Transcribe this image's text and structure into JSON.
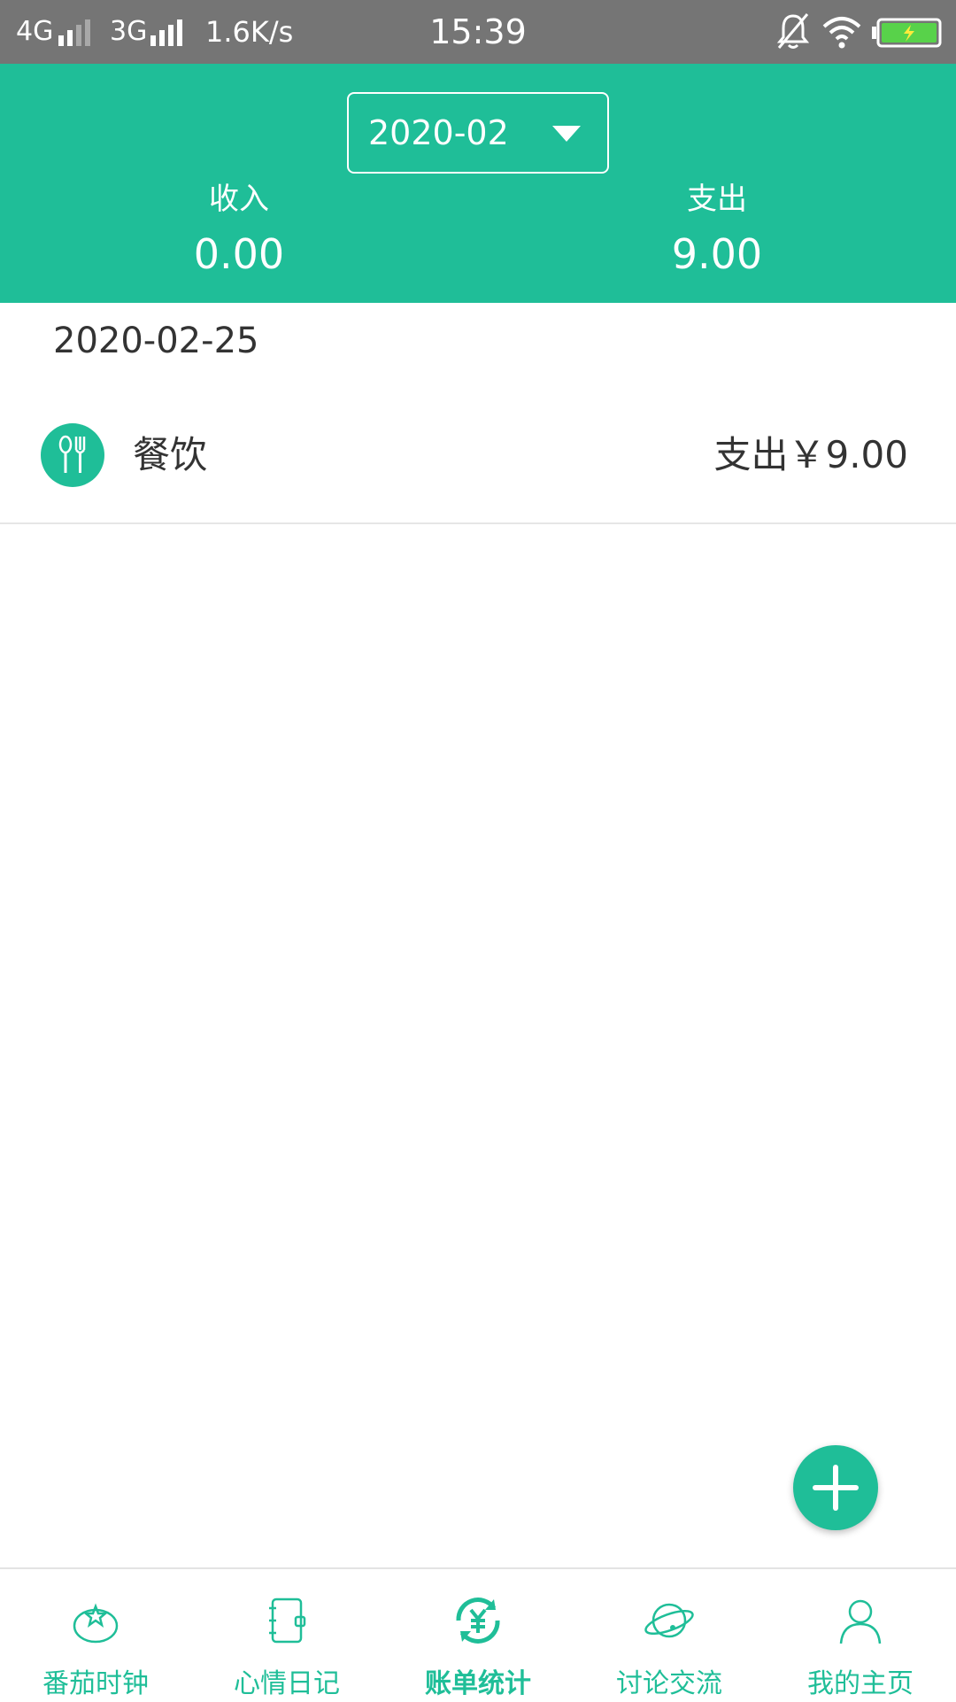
{
  "status_bar": {
    "network1": "4G",
    "network2": "3G",
    "speed": "1.6K/s",
    "time": "15:39",
    "icons": [
      "signal-icon",
      "mute-icon",
      "wifi-icon",
      "battery-charging-icon"
    ]
  },
  "header": {
    "month": "2020-02",
    "income_label": "收入",
    "income_value": "0.00",
    "expense_label": "支出",
    "expense_value": "9.00"
  },
  "records": {
    "date": "2020-02-25",
    "items": [
      {
        "icon": "utensils-icon",
        "category": "餐饮",
        "amount": "支出￥9.00"
      }
    ]
  },
  "fab": {
    "icon": "plus-icon"
  },
  "bottom_nav": {
    "items": [
      {
        "label": "番茄时钟",
        "icon": "tomato-icon"
      },
      {
        "label": "心情日记",
        "icon": "notebook-icon"
      },
      {
        "label": "账单统计",
        "icon": "yuan-refresh-icon",
        "active": true
      },
      {
        "label": "讨论交流",
        "icon": "planet-icon"
      },
      {
        "label": "我的主页",
        "icon": "user-icon"
      }
    ]
  },
  "colors": {
    "accent": "#1fbe98",
    "status_bar": "#757575",
    "text": "#333333"
  }
}
